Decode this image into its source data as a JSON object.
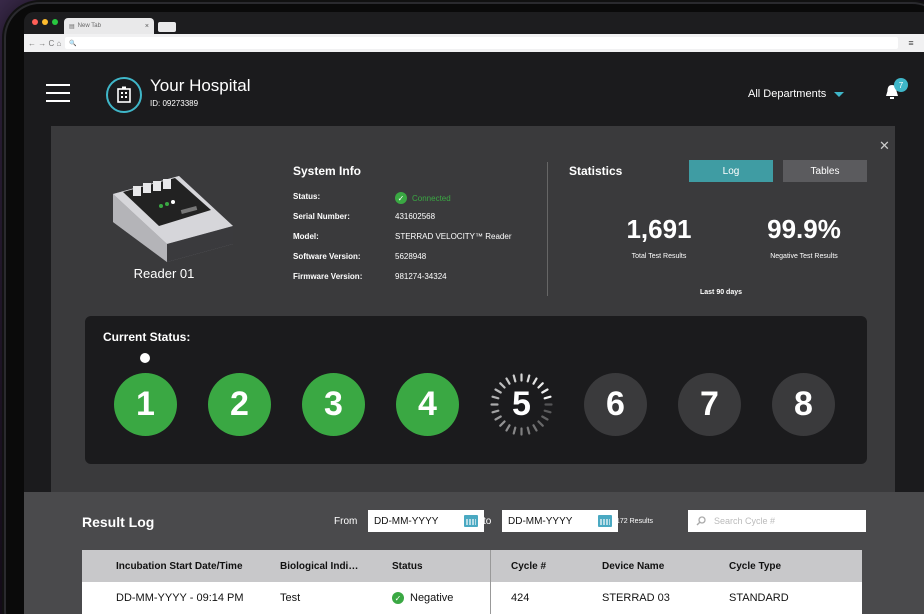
{
  "browser": {
    "tab_title": "New Tab",
    "tab_close": "×",
    "nav_icons": "← → C ⌂",
    "url_placeholder": "🔍"
  },
  "header": {
    "hospital_name": "Your Hospital",
    "hospital_id": "ID: 09273389",
    "department": "All Departments",
    "notification_count": "7"
  },
  "reader": {
    "label": "Reader 01"
  },
  "system_info": {
    "title": "System Info",
    "rows": [
      {
        "key": "Status:",
        "value": "Connected"
      },
      {
        "key": "Serial Number:",
        "value": "431602568"
      },
      {
        "key": "Model:",
        "value": "STERRAD VELOCITY™ Reader"
      },
      {
        "key": "Software Version:",
        "value": "5628948"
      },
      {
        "key": "Firmware Version:",
        "value": "981274-34324"
      }
    ]
  },
  "statistics": {
    "title": "Statistics",
    "log_label": "Log",
    "tables_label": "Tables",
    "total_value": "1,691",
    "total_label": "Total Test Results",
    "negative_value": "99.9%",
    "negative_label": "Negative Test Results",
    "period": "Last 90 days"
  },
  "current_status": {
    "title": "Current Status:",
    "steps": [
      "1",
      "2",
      "3",
      "4",
      "5",
      "6",
      "7",
      "8"
    ],
    "completed": 4,
    "active": 5
  },
  "result_log": {
    "title": "Result Log",
    "from_label": "From",
    "from_placeholder": "DD-MM-YYYY",
    "to_label": "to",
    "to_placeholder": "DD-MM-YYYY",
    "results_count": "172 Results",
    "search_placeholder": "Search Cycle #",
    "columns": [
      "Incubation Start Date/Time",
      "Biological Indi…",
      "Status",
      "Cycle #",
      "Device Name",
      "Cycle Type"
    ],
    "rows": [
      {
        "date": "DD-MM-YYYY -  09:14 PM",
        "bi": "Test",
        "status": "Negative",
        "cycle": "424",
        "device": "STERRAD 03",
        "type": "STANDARD"
      }
    ]
  },
  "colors": {
    "accent": "#3fb6c8",
    "success": "#3aa843",
    "log_button": "#3f9ca3"
  }
}
